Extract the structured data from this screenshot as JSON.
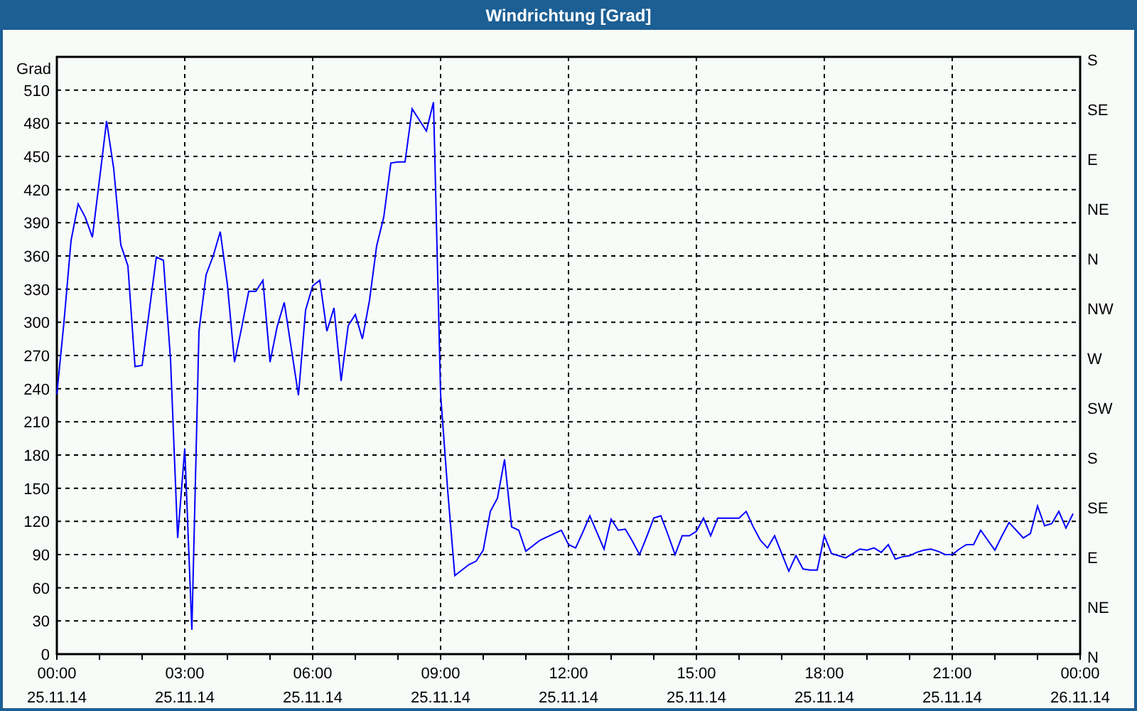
{
  "window": {
    "title": "Windrichtung [Grad]"
  },
  "chart_data": {
    "type": "line",
    "grid": true,
    "ylabel": "Grad",
    "ylim": [
      0,
      540
    ],
    "yticks": [
      0,
      30,
      60,
      90,
      120,
      150,
      180,
      210,
      240,
      270,
      300,
      330,
      360,
      390,
      420,
      450,
      480,
      510
    ],
    "categories": [
      "00:00 25.11.14",
      null,
      null,
      null,
      null,
      null,
      null,
      null,
      null,
      null,
      null,
      null,
      null,
      null,
      null,
      null,
      null,
      null,
      "03:00 25.11.14",
      null,
      null,
      null,
      null,
      null,
      null,
      null,
      null,
      null,
      null,
      null,
      null,
      null,
      null,
      null,
      null,
      null,
      "06:00 25.11.14",
      null,
      null,
      null,
      null,
      null,
      null,
      null,
      null,
      null,
      null,
      null,
      null,
      null,
      null,
      null,
      null,
      null,
      "09:00 25.11.14",
      null,
      null,
      null,
      null,
      null,
      null,
      null,
      null,
      null,
      null,
      null,
      null,
      null,
      null,
      null,
      null,
      null,
      "12:00 25.11.14",
      null,
      null,
      null,
      null,
      null,
      null,
      null,
      null,
      null,
      null,
      null,
      null,
      null,
      null,
      null,
      null,
      null,
      "15:00 25.11.14",
      null,
      null,
      null,
      null,
      null,
      null,
      null,
      null,
      null,
      null,
      null,
      null,
      null,
      null,
      null,
      null,
      null,
      "18:00 25.11.14",
      null,
      null,
      null,
      null,
      null,
      null,
      null,
      null,
      null,
      null,
      null,
      null,
      null,
      null,
      null,
      null,
      null,
      "21:00 25.11.14",
      null,
      null,
      null,
      null,
      null,
      null,
      null,
      null,
      null,
      null,
      null,
      null,
      null,
      null,
      null,
      null,
      null,
      "00:00 26.11.14"
    ],
    "series": [
      {
        "color": "#0000ff",
        "values": [
          235,
          300,
          374,
          407,
          395,
          377,
          429,
          482,
          439,
          370,
          351,
          260,
          261,
          310,
          359,
          356,
          266,
          105,
          186,
          22,
          292,
          343,
          360,
          382,
          334,
          264,
          295,
          328,
          328,
          338,
          264,
          296,
          318,
          276,
          234,
          311,
          333,
          338,
          292,
          313,
          247,
          297,
          307,
          285,
          320,
          369,
          395,
          444,
          445,
          445,
          493,
          483,
          473,
          499,
          235,
          148,
          71,
          76,
          81,
          84,
          94,
          129,
          141,
          176,
          115,
          112,
          93,
          98,
          103,
          106,
          109,
          112,
          99,
          96,
          110,
          125,
          110,
          95,
          122,
          112,
          113,
          102,
          90,
          106,
          123,
          125,
          108,
          90,
          107,
          107,
          111,
          123,
          107,
          123,
          123,
          123,
          123,
          129,
          115,
          103,
          96,
          107,
          91,
          75,
          89,
          77,
          76,
          76,
          107,
          91,
          89,
          87,
          91,
          95,
          94,
          96,
          92,
          99,
          86,
          88,
          89,
          92,
          94,
          95,
          93,
          90,
          90,
          95,
          99,
          99,
          112,
          103,
          94,
          107,
          119,
          112,
          105,
          109,
          134,
          116,
          118,
          129,
          114,
          127,
          null
        ]
      }
    ]
  },
  "right_axis_labels": [
    "S",
    "SE",
    "E",
    "NE",
    "N",
    "NW",
    "W",
    "SW",
    "S",
    "SE",
    "E",
    "NE",
    "N"
  ]
}
